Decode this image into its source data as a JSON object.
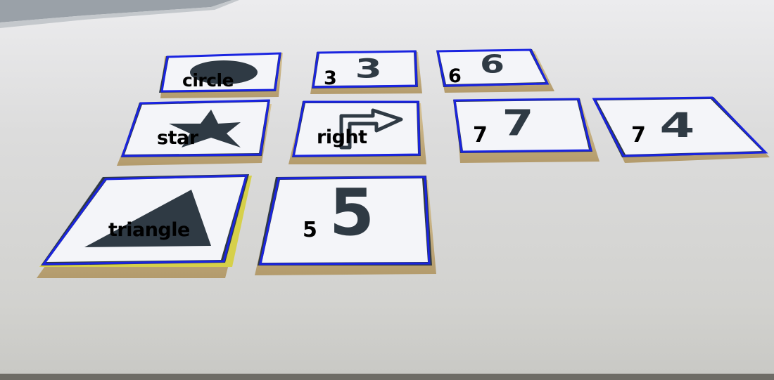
{
  "tiles": [
    {
      "id": "circle",
      "symbol": "circle",
      "label": "circle"
    },
    {
      "id": "three",
      "symbol": "3",
      "label": "3"
    },
    {
      "id": "six",
      "symbol": "6",
      "label": "6"
    },
    {
      "id": "star",
      "symbol": "star",
      "label": "star"
    },
    {
      "id": "right",
      "symbol": "right-arrow",
      "label": "right"
    },
    {
      "id": "seven",
      "symbol": "7",
      "label": "7"
    },
    {
      "id": "four",
      "symbol": "4",
      "label": "7"
    },
    {
      "id": "triangle",
      "symbol": "triangle",
      "label": "triangle"
    },
    {
      "id": "five",
      "symbol": "5",
      "label": "5"
    }
  ],
  "colors": {
    "table": "#d9d9d7",
    "card_face": "#f4f5f9",
    "card_border": "#2f3a44",
    "card_wood": "#c9b48a",
    "detection_outline": "#1a24e0",
    "symbol": "#2f3a44",
    "label_text": "#000000"
  }
}
